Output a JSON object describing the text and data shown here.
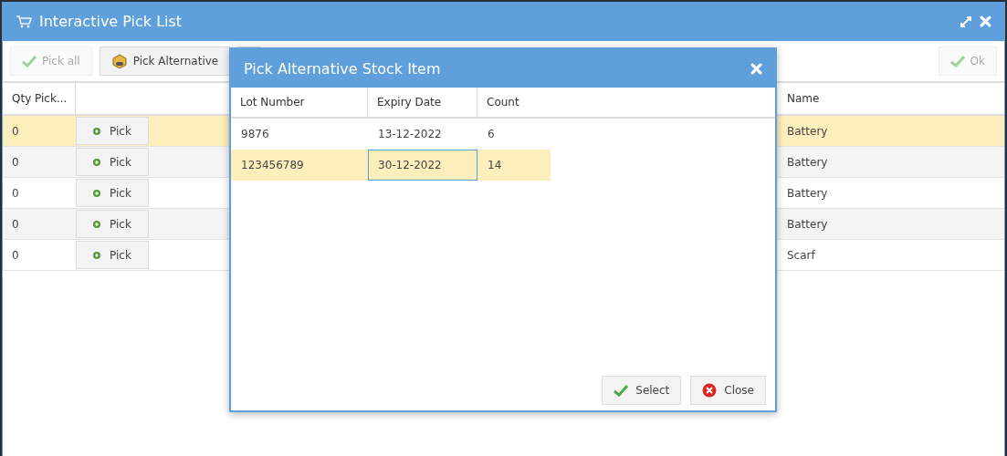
{
  "window": {
    "title": "Interactive Pick List"
  },
  "toolbar": {
    "buttons": [
      {
        "label": "Pick all",
        "disabled": true
      },
      {
        "label": "Pick Alternative",
        "disabled": false
      }
    ],
    "ok": {
      "label": "Ok",
      "disabled": true
    }
  },
  "grid": {
    "columns": [
      "Qty Pick...",
      "Name"
    ],
    "rows": [
      {
        "qty": "0",
        "action": "Pick",
        "name": "Battery",
        "selected": true
      },
      {
        "qty": "0",
        "action": "Pick",
        "name": "Battery",
        "selected": false
      },
      {
        "qty": "0",
        "action": "Pick",
        "name": "Battery",
        "selected": false
      },
      {
        "qty": "0",
        "action": "Pick",
        "name": "Battery",
        "selected": false
      },
      {
        "qty": "0",
        "action": "Pick",
        "name": "Scarf",
        "selected": false
      }
    ]
  },
  "dialog": {
    "title": "Pick Alternative Stock Item",
    "columns": [
      "Lot Number",
      "Expiry Date",
      "Count"
    ],
    "rows": [
      {
        "selected": false,
        "cells": [
          {
            "text": "9876",
            "focused": false
          },
          {
            "text": "13-12-2022",
            "focused": false
          },
          {
            "text": "6",
            "focused": false
          }
        ]
      },
      {
        "selected": true,
        "cells": [
          {
            "text": "123456789",
            "focused": false
          },
          {
            "text": "30-12-2022",
            "focused": true
          },
          {
            "text": "14",
            "focused": false
          }
        ]
      }
    ],
    "buttons": [
      {
        "kind": "select",
        "label": "Select"
      },
      {
        "kind": "close",
        "label": "Close"
      }
    ]
  }
}
